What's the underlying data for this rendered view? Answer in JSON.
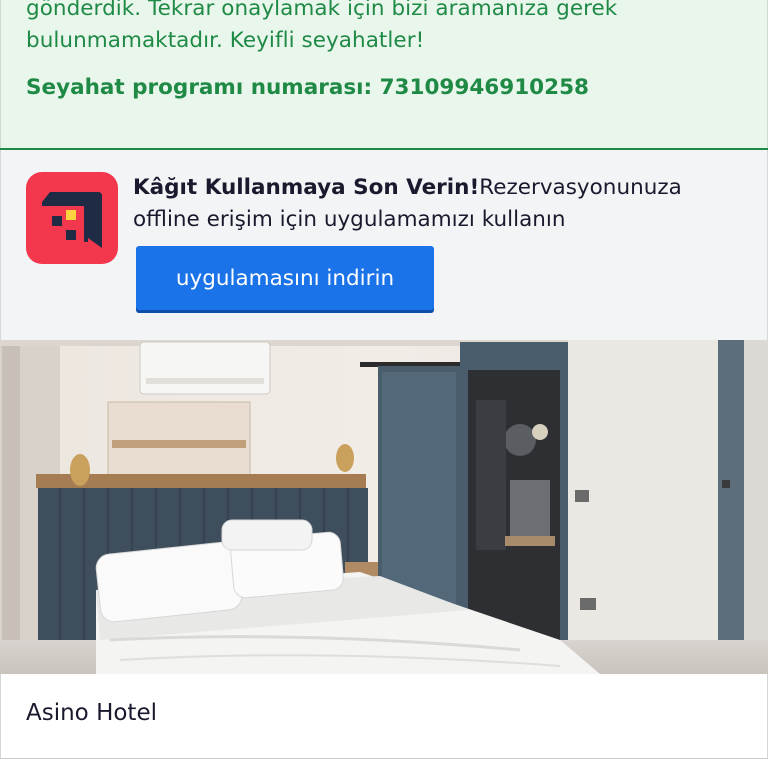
{
  "confirmation": {
    "line1": "gönderdik. Tekrar onaylamak için bizi aramanıza gerek",
    "line2": "bulunmamaktadır. Keyifli seyahatler!",
    "itinerary_label": "Seyahat programı numarası: 73109946910258"
  },
  "app_banner": {
    "icon": "app-logo-icon",
    "title": "Kâğıt Kullanmaya Son Verin!",
    "body_line1": "Rezervasyonunuza",
    "body_line2": "offline erişim için uygulamamızı kullanın",
    "download_label": "uygulamasını indirin"
  },
  "hotel": {
    "photo": "hotel-room-photo",
    "name": "Asino Hotel"
  },
  "colors": {
    "success_green": "#1f8a45",
    "success_bg": "#e9f6ec",
    "brand_red": "#f3384d",
    "button_blue": "#1a73e8"
  }
}
